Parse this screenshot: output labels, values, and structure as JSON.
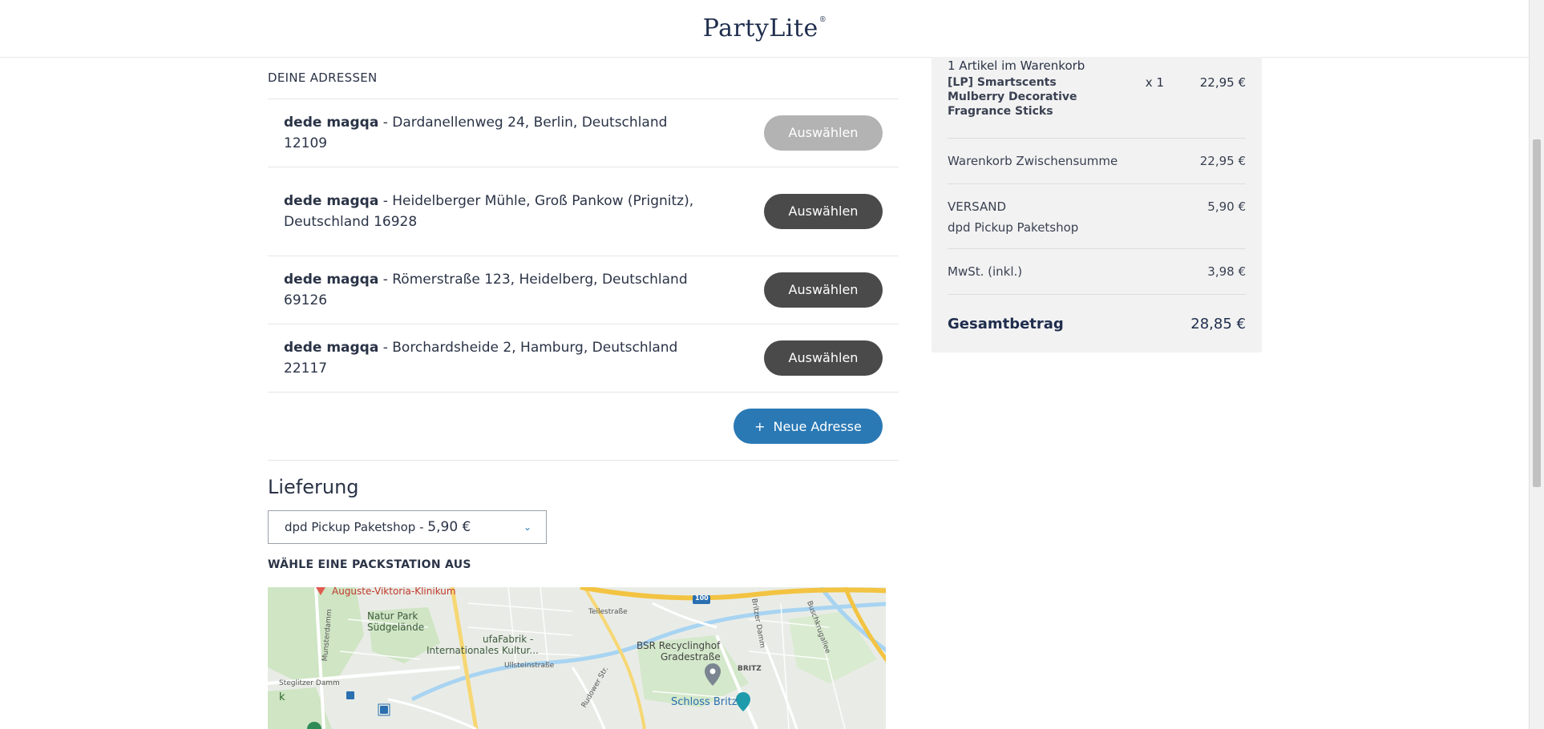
{
  "header": {
    "logo_text": "PartyLite",
    "logo_reg": "®"
  },
  "addresses": {
    "section_label": "DEINE ADRESSEN",
    "items": [
      {
        "name": "dede magqa",
        "address": " - Dardanellenweg 24, Berlin, Deutschland 12109",
        "button": "Auswählen",
        "disabled": true
      },
      {
        "name": "dede magqa",
        "address": " - Heidelberger Mühle, Groß Pankow (Prignitz), Deutschland 16928",
        "button": "Auswählen",
        "disabled": false
      },
      {
        "name": "dede magqa",
        "address": " - Römerstraße 123, Heidelberg, Deutschland 69126",
        "button": "Auswählen",
        "disabled": false
      },
      {
        "name": "dede magqa",
        "address": " - Borchardsheide 2, Hamburg, Deutschland 22117",
        "button": "Auswählen",
        "disabled": false
      }
    ],
    "new_address": {
      "icon": "plus-icon",
      "plus": "+",
      "label": "Neue Adresse"
    }
  },
  "delivery": {
    "title": "Lieferung",
    "selected_option": "dpd Pickup Paketshop - ",
    "selected_price": "5,90 €",
    "chevron": "⌄",
    "packstation_label": "WÄHLE EINE PACKSTATION AUS"
  },
  "map": {
    "labels": {
      "hospital": "Auguste-Viktoria-Klinikum",
      "park1": "Natur Park",
      "park2": "Südgelände",
      "ufa1": "ufaFabrik -",
      "ufa2": "Internationales Kultur...",
      "bsr1": "BSR Recyclinghof",
      "bsr2": "Gradestraße",
      "schloss": "Schloss Britz",
      "britz": "BRITZ",
      "teile": "Teilestraße",
      "ulli": "Ullsteinstraße",
      "steglitzer": "Steglitzer Damm",
      "route": "100",
      "britzer_damm": "Britzer Damm",
      "buschkrug": "Buschkrugallee",
      "munster": "Munsterdamm",
      "rudow": "Rudower Str.",
      "k": "k"
    }
  },
  "summary": {
    "count": "1 Artikel im Warenkorb",
    "item": {
      "title": "[LP] Smartscents Mulberry Decorative Fragrance Sticks",
      "qty": "x 1",
      "price": "22,95 €"
    },
    "subtotal": {
      "label": "Warenkorb Zwischensumme",
      "value": "22,95 €"
    },
    "shipping": {
      "label": "VERSAND",
      "method": "dpd Pickup Paketshop",
      "value": "5,90 €"
    },
    "tax": {
      "label": "MwSt. (inkl.)",
      "value": "3,98 €"
    },
    "total": {
      "label": "Gesamtbetrag",
      "value": "28,85 €"
    }
  }
}
